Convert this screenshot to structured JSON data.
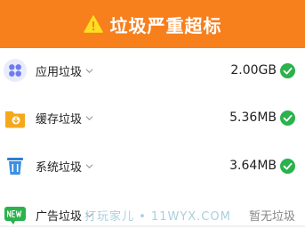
{
  "banner": {
    "title": "垃圾严重超标",
    "icon": "warning-icon",
    "color": "#f77f1c"
  },
  "items": [
    {
      "label": "应用垃圾",
      "value": "2.00GB",
      "icon": "apps-icon",
      "status": "check-icon"
    },
    {
      "label": "缓存垃圾",
      "value": "5.36MB",
      "icon": "cache-folder-icon",
      "status": "check-icon"
    },
    {
      "label": "系统垃圾",
      "value": "3.64MB",
      "icon": "trash-bin-icon",
      "status": "check-icon"
    },
    {
      "label": "广告垃圾",
      "value": "暂无垃圾",
      "icon": "new-badge-icon"
    }
  ],
  "watermark": "打玩家儿 • 11WYX.COM",
  "colors": {
    "check": "#2bb24c",
    "muted": "#888888"
  }
}
